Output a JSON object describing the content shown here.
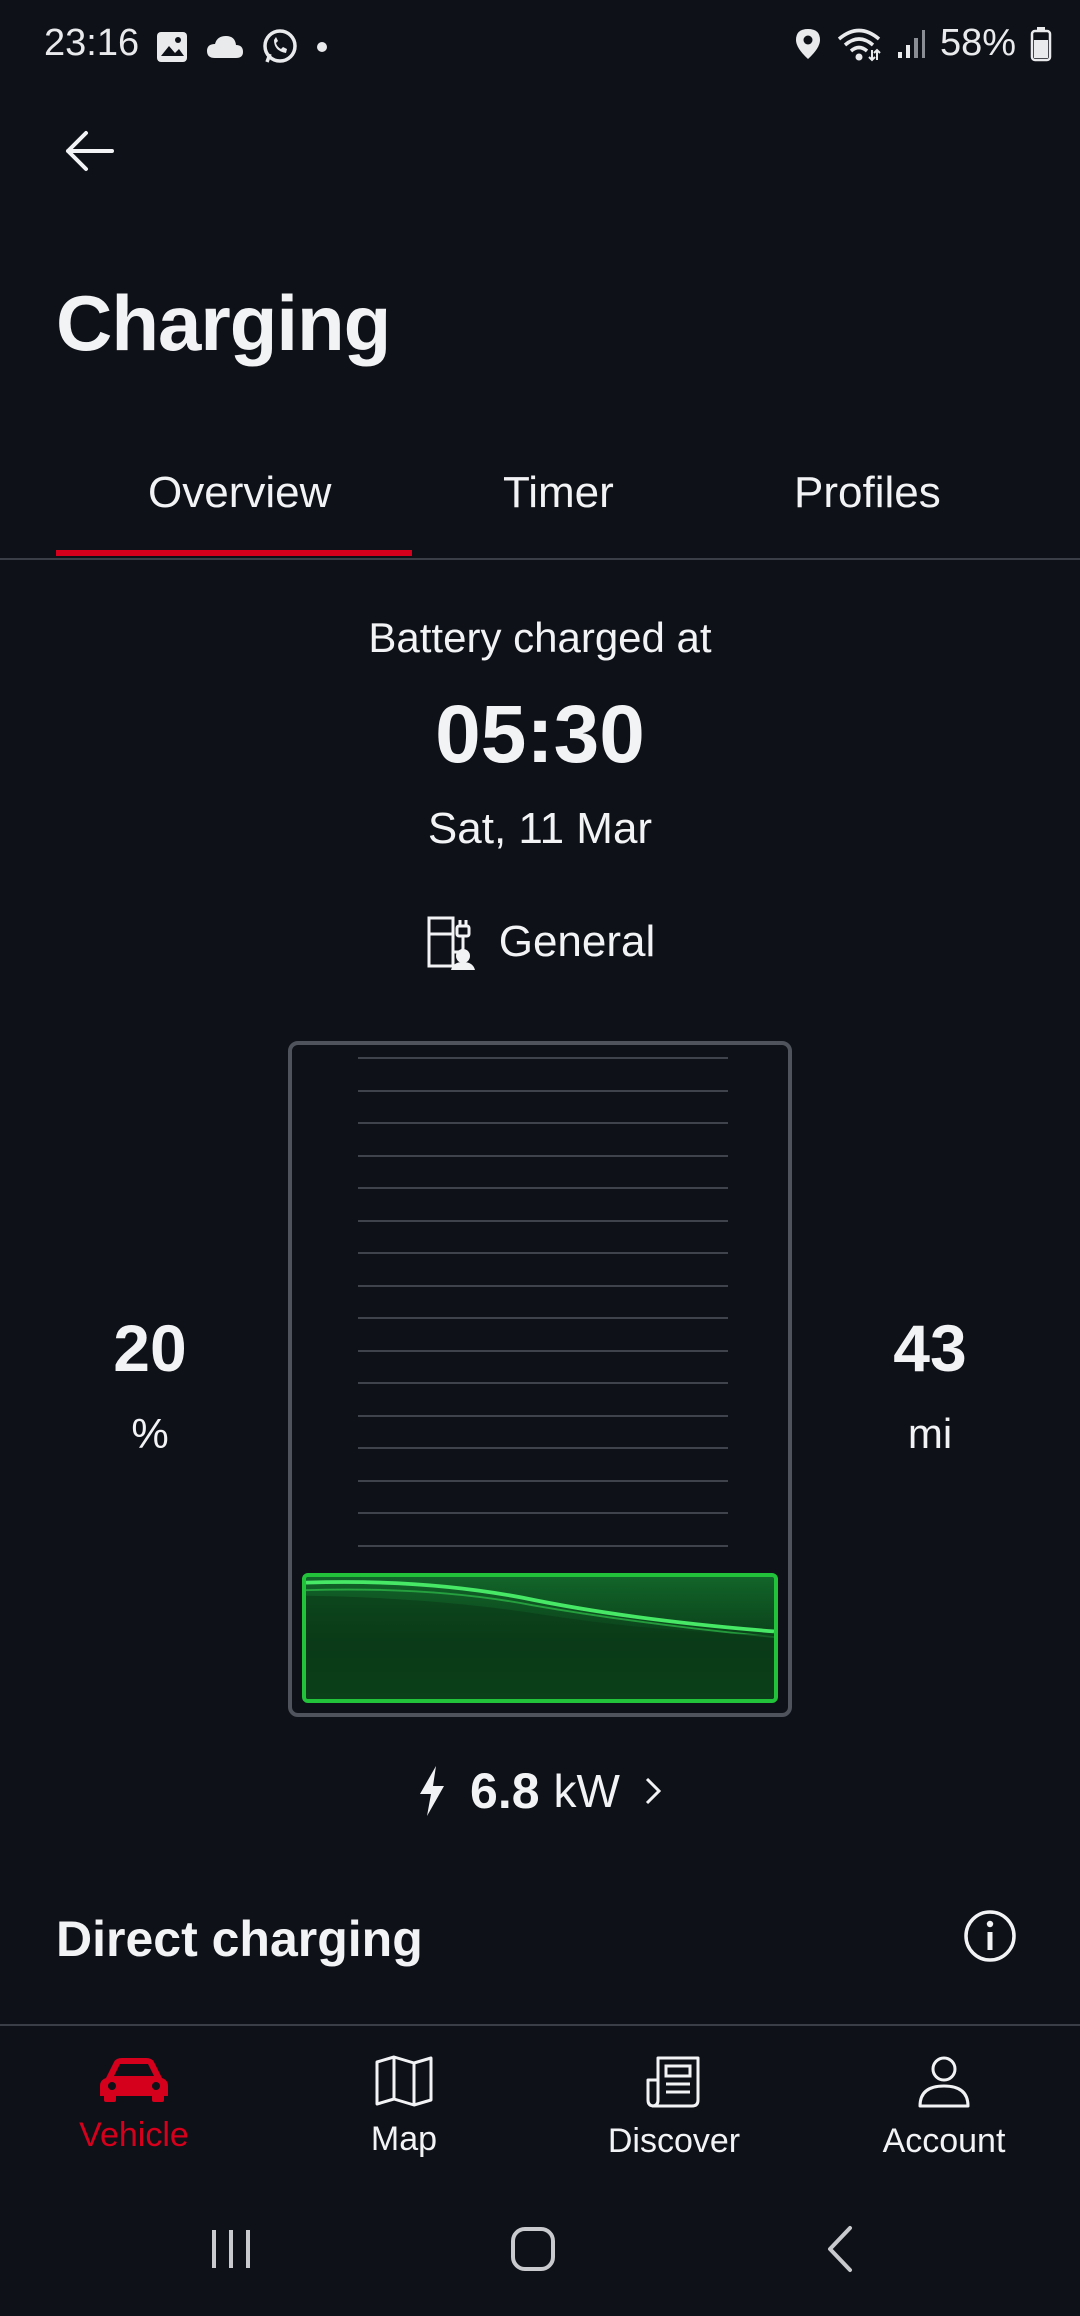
{
  "status_bar": {
    "time": "23:16",
    "battery_percent": "58%",
    "icons": [
      "image-icon",
      "cloud-icon",
      "whatsapp-icon",
      "dot-icon",
      "location-icon",
      "wifi-icon",
      "signal-icon",
      "battery-icon"
    ]
  },
  "header": {
    "title": "Charging"
  },
  "tabs": [
    {
      "label": "Overview",
      "active": true
    },
    {
      "label": "Timer",
      "active": false
    },
    {
      "label": "Profiles",
      "active": false
    }
  ],
  "charge_status": {
    "label": "Battery charged at",
    "time": "05:30",
    "date": "Sat, 11 Mar",
    "profile": "General"
  },
  "battery": {
    "soc_value": "20",
    "soc_unit": "%",
    "range_value": "43",
    "range_unit": "mi",
    "fill_fraction": 0.2
  },
  "power": {
    "value": "6.8",
    "unit": "kW"
  },
  "direct_charging": {
    "title": "Direct charging"
  },
  "bottom_nav": [
    {
      "label": "Vehicle",
      "icon": "car-icon",
      "active": true
    },
    {
      "label": "Map",
      "icon": "map-icon",
      "active": false
    },
    {
      "label": "Discover",
      "icon": "news-icon",
      "active": false
    },
    {
      "label": "Account",
      "icon": "account-icon",
      "active": false
    }
  ],
  "colors": {
    "background": "#0e1118",
    "accent": "#d5001c",
    "battery_green": "#22c23a"
  }
}
